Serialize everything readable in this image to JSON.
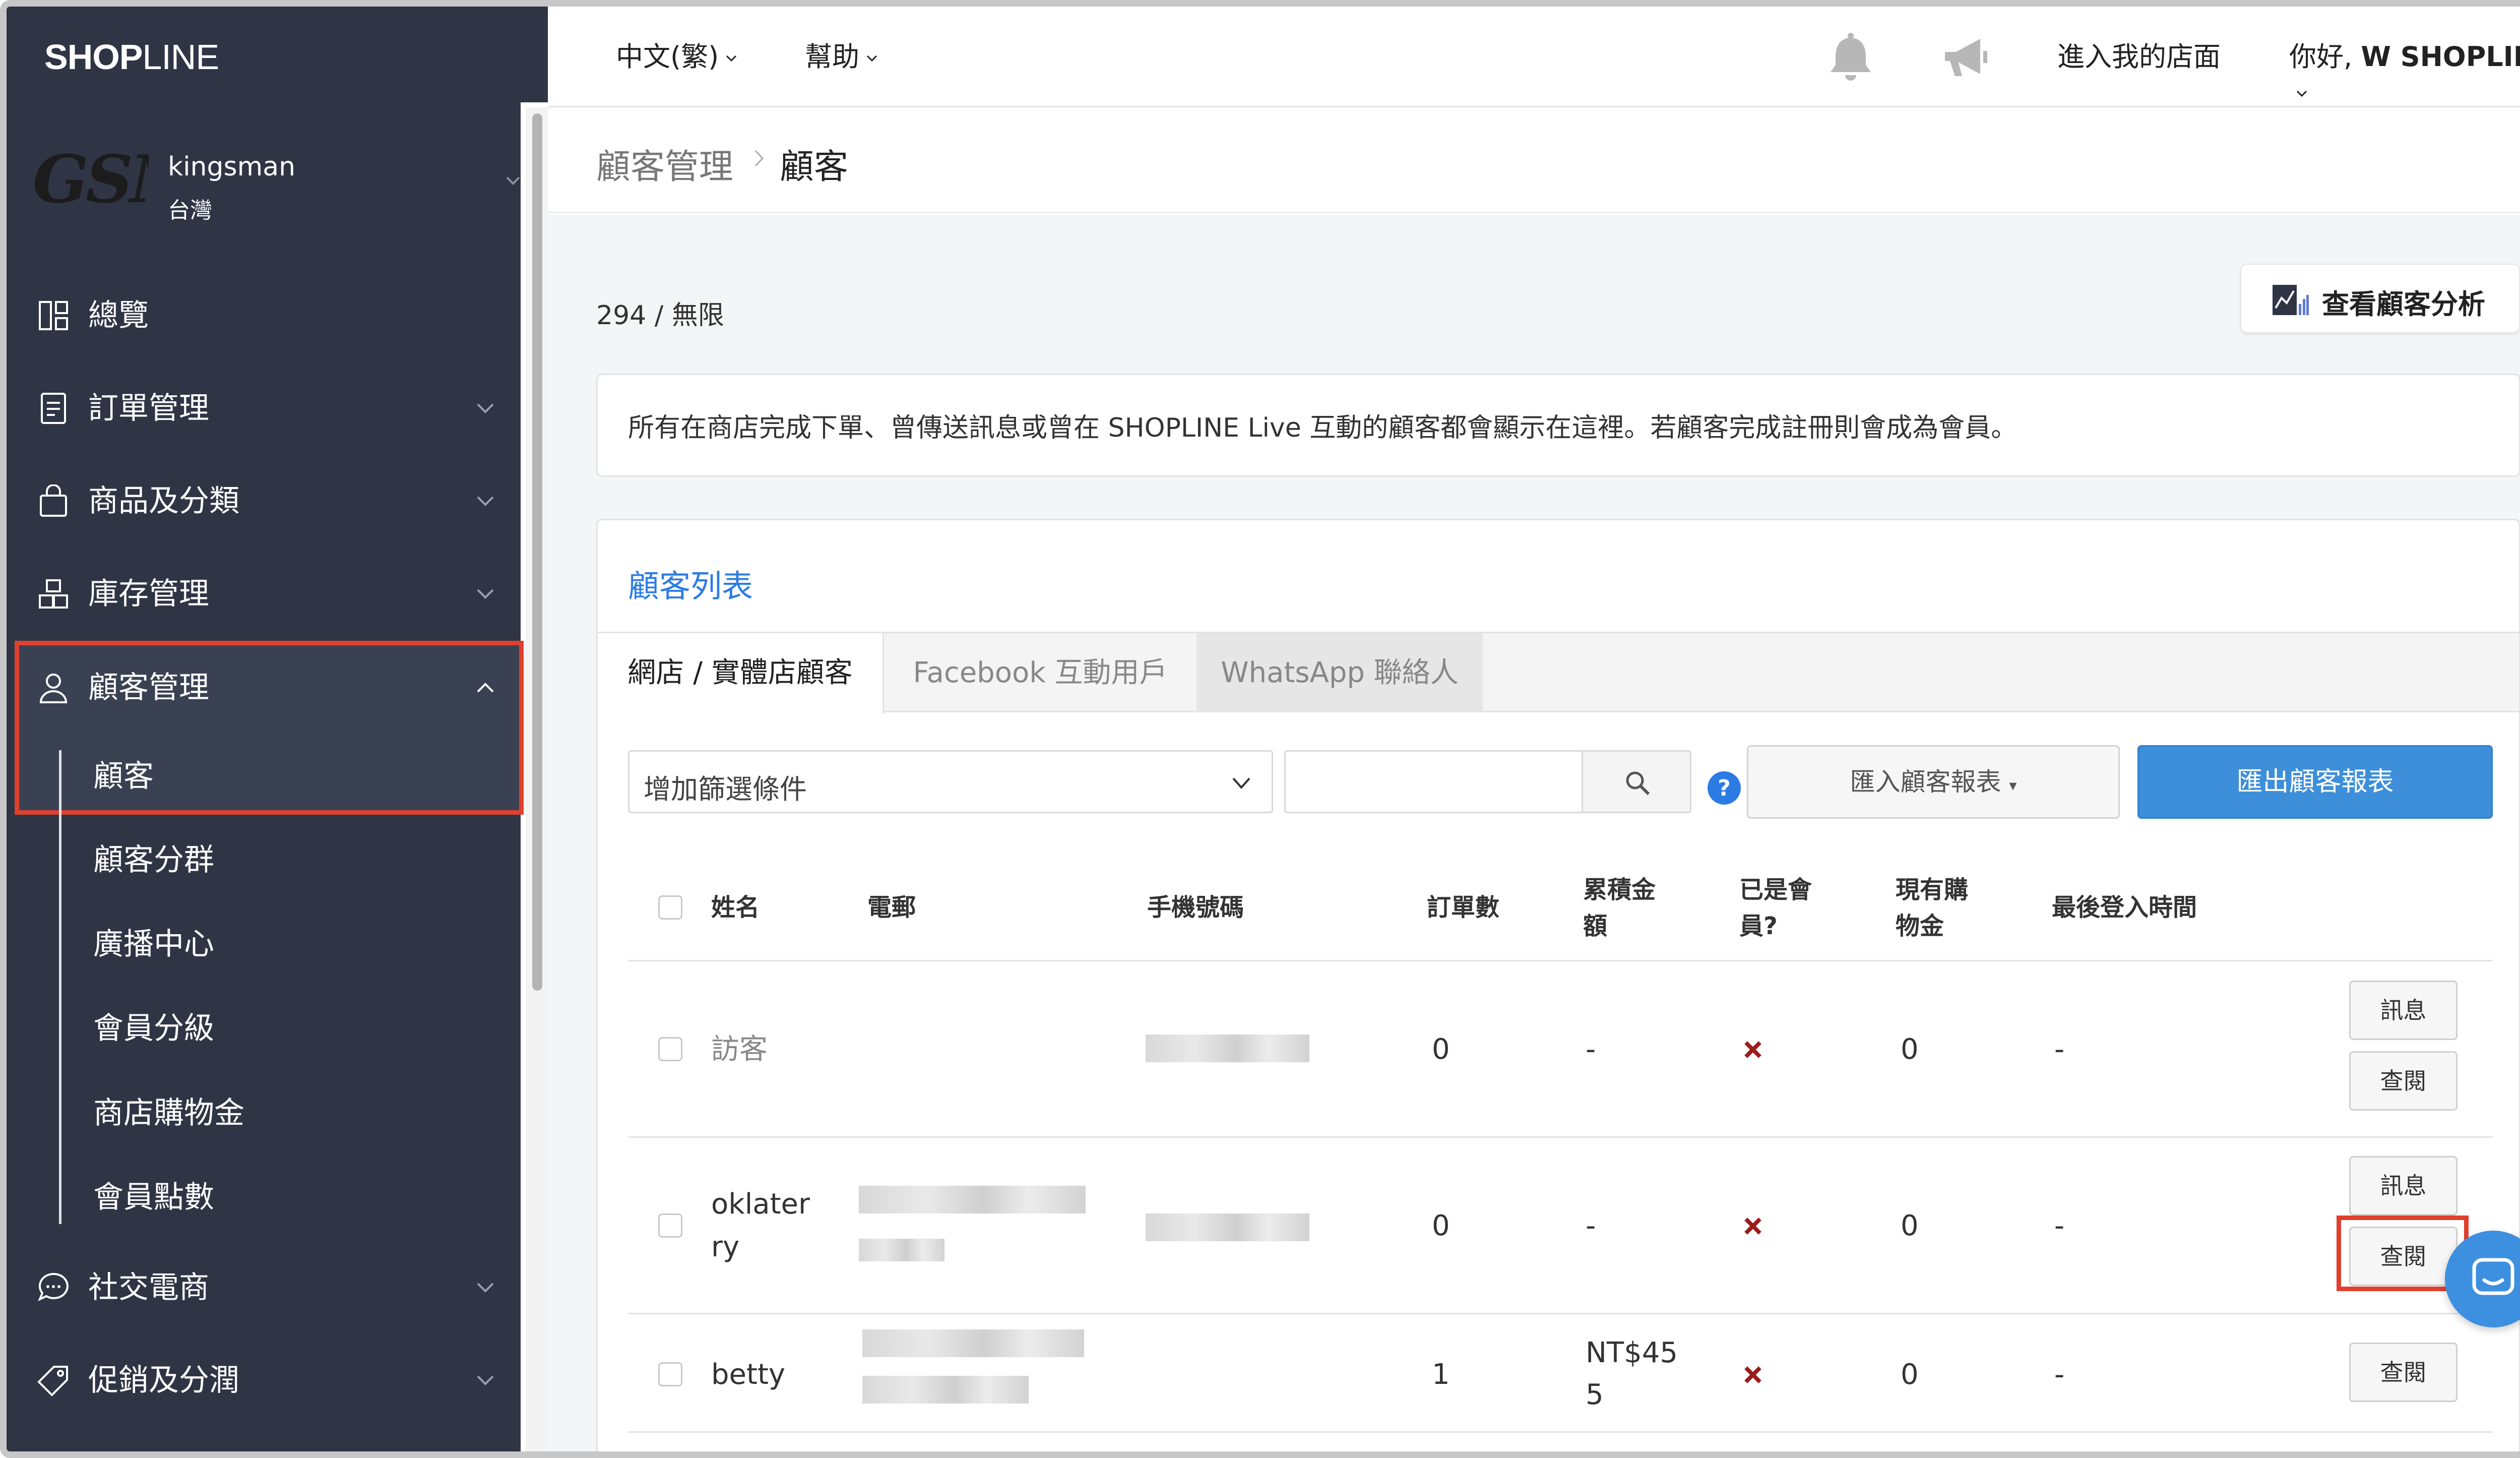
{
  "brand": {
    "logo_bold": "SHOP",
    "logo_light": "LINE"
  },
  "store": {
    "avatar_text": "GSM",
    "name": "kingsman",
    "region": "台灣"
  },
  "sidebar": {
    "items": [
      {
        "label": "總覽",
        "icon": "dashboard-icon"
      },
      {
        "label": "訂單管理",
        "icon": "order-icon"
      },
      {
        "label": "商品及分類",
        "icon": "shopping-bag-icon"
      },
      {
        "label": "庫存管理",
        "icon": "inventory-icon"
      },
      {
        "label": "顧客管理",
        "icon": "user-icon"
      },
      {
        "label": "社交電商",
        "icon": "chat-icon"
      },
      {
        "label": "促銷及分潤",
        "icon": "tag-icon"
      }
    ],
    "sub_items": [
      "顧客",
      "顧客分群",
      "廣播中心",
      "會員分級",
      "商店購物金",
      "會員點數"
    ]
  },
  "topbar": {
    "language": "中文(繁)",
    "help": "幫助",
    "store_link": "進入我的店面",
    "greeting": "你好,",
    "user": "W SHOPLINE"
  },
  "breadcrumb": {
    "parent": "顧客管理",
    "current": "顧客"
  },
  "summary": {
    "count": "294 / 無限",
    "analysis_button": "查看顧客分析"
  },
  "info": {
    "text": "所有在商店完成下單、曾傳送訊息或曾在 SHOPLINE Live 互動的顧客都會顯示在這裡。若顧客完成註冊則會成為會員。"
  },
  "list": {
    "title": "顧客列表",
    "tabs": [
      "網店 / 實體店顧客",
      "Facebook 互動用戶",
      "WhatsApp 聯絡人"
    ],
    "filter_placeholder": "增加篩選條件",
    "search_value": "",
    "import_button": "匯入顧客報表",
    "export_button": "匯出顧客報表",
    "columns": {
      "name": "姓名",
      "email": "電郵",
      "phone": "手機號碼",
      "orders": "訂單數",
      "total_1": "累積金",
      "total_2": "額",
      "member_1": "已是會",
      "member_2": "員?",
      "credit_1": "現有購",
      "credit_2": "物金",
      "last_login": "最後登入時間"
    },
    "rows": [
      {
        "name": "訪客",
        "orders": "0",
        "total": "-",
        "credit": "0",
        "last_login": "-"
      },
      {
        "name_1": "oklater",
        "name_2": "ry",
        "orders": "0",
        "total": "-",
        "credit": "0",
        "last_login": "-"
      },
      {
        "name": "betty",
        "orders": "1",
        "total_1": "NT$45",
        "total_2": "5",
        "credit": "0",
        "last_login": "-"
      }
    ],
    "actions": {
      "message": "訊息",
      "view": "查閱"
    },
    "next_row_hint": "…"
  },
  "colors": {
    "sidebar": "#2f3545",
    "accent": "#3d8fd9",
    "highlight": "#e0402e",
    "cross": "#9b1c1c"
  }
}
